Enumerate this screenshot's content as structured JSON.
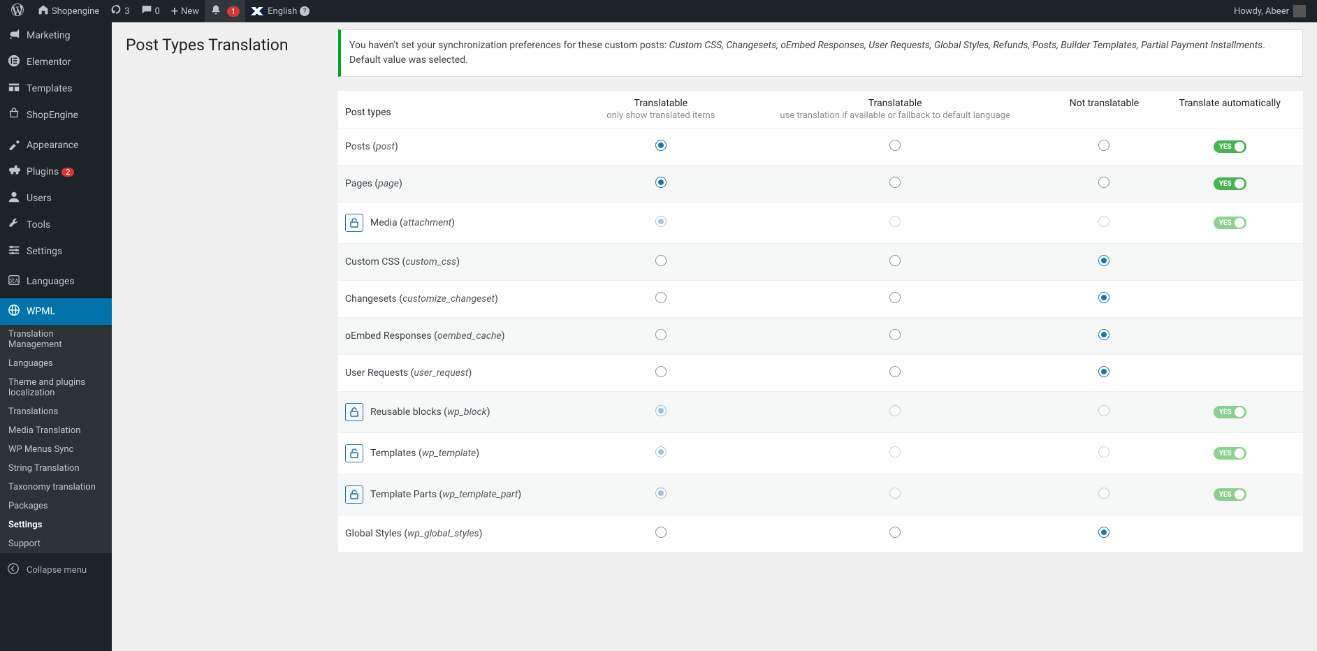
{
  "adminbar": {
    "site_name": "Shopengine",
    "updates": "3",
    "comments": "0",
    "new": "New",
    "notification_count": "1",
    "language": "English",
    "howdy": "Howdy, Abeer"
  },
  "sidebar": {
    "items": [
      {
        "icon": "megaphone",
        "label": "Marketing"
      },
      {
        "icon": "elementor",
        "label": "Elementor"
      },
      {
        "icon": "templates",
        "label": "Templates"
      },
      {
        "icon": "shopengine",
        "label": "ShopEngine"
      },
      {
        "icon": "appearance",
        "label": "Appearance"
      },
      {
        "icon": "plugins",
        "label": "Plugins",
        "badge": "2"
      },
      {
        "icon": "users",
        "label": "Users"
      },
      {
        "icon": "tools",
        "label": "Tools"
      },
      {
        "icon": "settings",
        "label": "Settings"
      },
      {
        "icon": "languages",
        "label": "Languages"
      },
      {
        "icon": "wpml",
        "label": "WPML",
        "current": true
      }
    ],
    "submenu": [
      {
        "label": "Translation Management"
      },
      {
        "label": "Languages"
      },
      {
        "label": "Theme and plugins localization"
      },
      {
        "label": "Translations"
      },
      {
        "label": "Media Translation"
      },
      {
        "label": "WP Menus Sync"
      },
      {
        "label": "String Translation"
      },
      {
        "label": "Taxonomy translation"
      },
      {
        "label": "Packages"
      },
      {
        "label": "Settings",
        "current": true
      },
      {
        "label": "Support"
      }
    ],
    "collapse": "Collapse menu"
  },
  "page": {
    "title": "Post Types Translation",
    "notice_prefix": "You haven't set your synchronization preferences for these custom posts: ",
    "notice_list": "Custom CSS, Changesets, oEmbed Responses, User Requests, Global Styles, Refunds, Posts, Builder Templates, Partial Payment Installments",
    "notice_suffix": ". Default value was selected."
  },
  "table": {
    "headers": {
      "post_types": "Post types",
      "translatable": "Translatable",
      "translatable_sub": "only show translated items",
      "fallback": "Translatable",
      "fallback_sub": "use translation if available or fallback to default language",
      "not_translatable": "Not translatable",
      "translate_auto": "Translate automatically"
    },
    "toggle_yes": "YES",
    "rows": [
      {
        "label": "Posts",
        "slug": "post",
        "locked": false,
        "selected": 0,
        "auto": true
      },
      {
        "label": "Pages",
        "slug": "page",
        "locked": false,
        "selected": 0,
        "auto": true
      },
      {
        "label": "Media",
        "slug": "attachment",
        "locked": true,
        "selected": 0,
        "auto": true
      },
      {
        "label": "Custom CSS",
        "slug": "custom_css",
        "locked": false,
        "selected": 2,
        "auto": false
      },
      {
        "label": "Changesets",
        "slug": "customize_changeset",
        "locked": false,
        "selected": 2,
        "auto": false
      },
      {
        "label": "oEmbed Responses",
        "slug": "oembed_cache",
        "locked": false,
        "selected": 2,
        "auto": false
      },
      {
        "label": "User Requests",
        "slug": "user_request",
        "locked": false,
        "selected": 2,
        "auto": false
      },
      {
        "label": "Reusable blocks",
        "slug": "wp_block",
        "locked": true,
        "selected": 0,
        "auto": true
      },
      {
        "label": "Templates",
        "slug": "wp_template",
        "locked": true,
        "selected": 0,
        "auto": true
      },
      {
        "label": "Template Parts",
        "slug": "wp_template_part",
        "locked": true,
        "selected": 0,
        "auto": true
      },
      {
        "label": "Global Styles",
        "slug": "wp_global_styles",
        "locked": false,
        "selected": 2,
        "auto": false
      }
    ]
  }
}
